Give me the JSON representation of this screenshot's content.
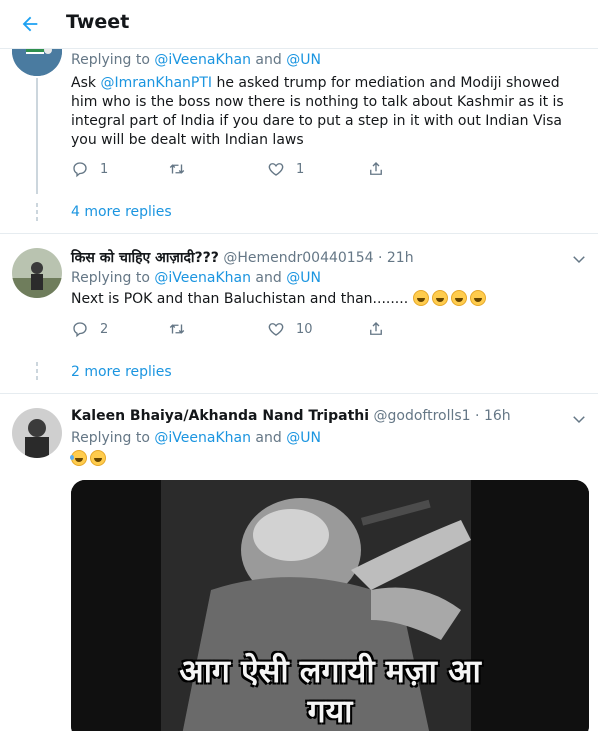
{
  "header": {
    "title": "Tweet"
  },
  "tweets": [
    {
      "replying_prefix": "Replying to",
      "replying_to": [
        "@iVeenaKhan",
        "@UN"
      ],
      "replying_and": "and",
      "text_before": "Ask ",
      "mention": "@ImranKhanPTI",
      "text_after": " he asked trump for mediation and Modiji showed him who is the boss now there is nothing to talk about Kashmir as it is integral part of India if you dare to put a step in it with out Indian Visa you will be dealt with Indian laws",
      "reply_count": "1",
      "retweet_count": "",
      "like_count": "1",
      "more_replies": "4 more replies"
    },
    {
      "name": "किस को चाहिए आज़ादी???",
      "handle": "@Hemendr00440154",
      "sep": "·",
      "time": "21h",
      "replying_prefix": "Replying to",
      "replying_to": [
        "@iVeenaKhan",
        "@UN"
      ],
      "replying_and": "and",
      "text": "Next is POK and than Baluchistan and than........",
      "reply_count": "2",
      "retweet_count": "",
      "like_count": "10",
      "more_replies": "2 more replies"
    },
    {
      "name": "Kaleen Bhaiya/Akhanda Nand Tripathi",
      "handle": "@godoftrolls1",
      "sep": "·",
      "time": "16h",
      "replying_prefix": "Replying to",
      "replying_to": [
        "@iVeenaKhan",
        "@UN"
      ],
      "replying_and": "and",
      "media_caption_line1": "आग ऐसी लगायी मज़ा आ",
      "media_caption_line2": "गया"
    }
  ],
  "icons": {
    "back": "arrow-left-icon",
    "reply": "reply-icon",
    "retweet": "retweet-icon",
    "like": "heart-icon",
    "share": "share-icon",
    "caret": "chevron-down-icon",
    "emoji": "laughing-emoji-icon"
  },
  "colors": {
    "accent": "#1b95e0",
    "muted": "#657786",
    "text": "#14171a",
    "border": "#e6ecf0"
  }
}
